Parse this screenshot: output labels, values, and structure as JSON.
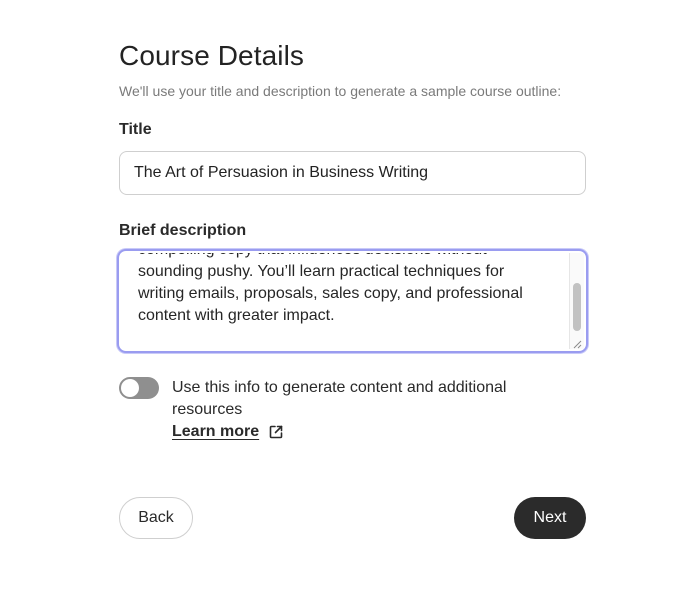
{
  "header": {
    "title": "Course Details",
    "subtitle": "We'll use your title and description to generate a sample course outline:"
  },
  "title_field": {
    "label": "Title",
    "value": "The Art of Persuasion in Business Writing"
  },
  "description_field": {
    "label": "Brief description",
    "lines": [
      "compelling copy that influences decisions without",
      "sounding pushy. You’ll learn practical techniques for",
      "writing emails, proposals, sales copy, and professional",
      "content with greater impact."
    ]
  },
  "toggle": {
    "label": "Use this info to generate content and additional resources",
    "checked": false,
    "learn_more": "Learn more"
  },
  "actions": {
    "back_label": "Back",
    "next_label": "Next"
  },
  "colors": {
    "focus_ring": "#9a9cf0",
    "toggle_off": "#8f8f8f",
    "primary_button": "#2b2b2b"
  },
  "icons": {
    "external_link": "external-link-icon",
    "resize": "resize-grip-icon"
  }
}
